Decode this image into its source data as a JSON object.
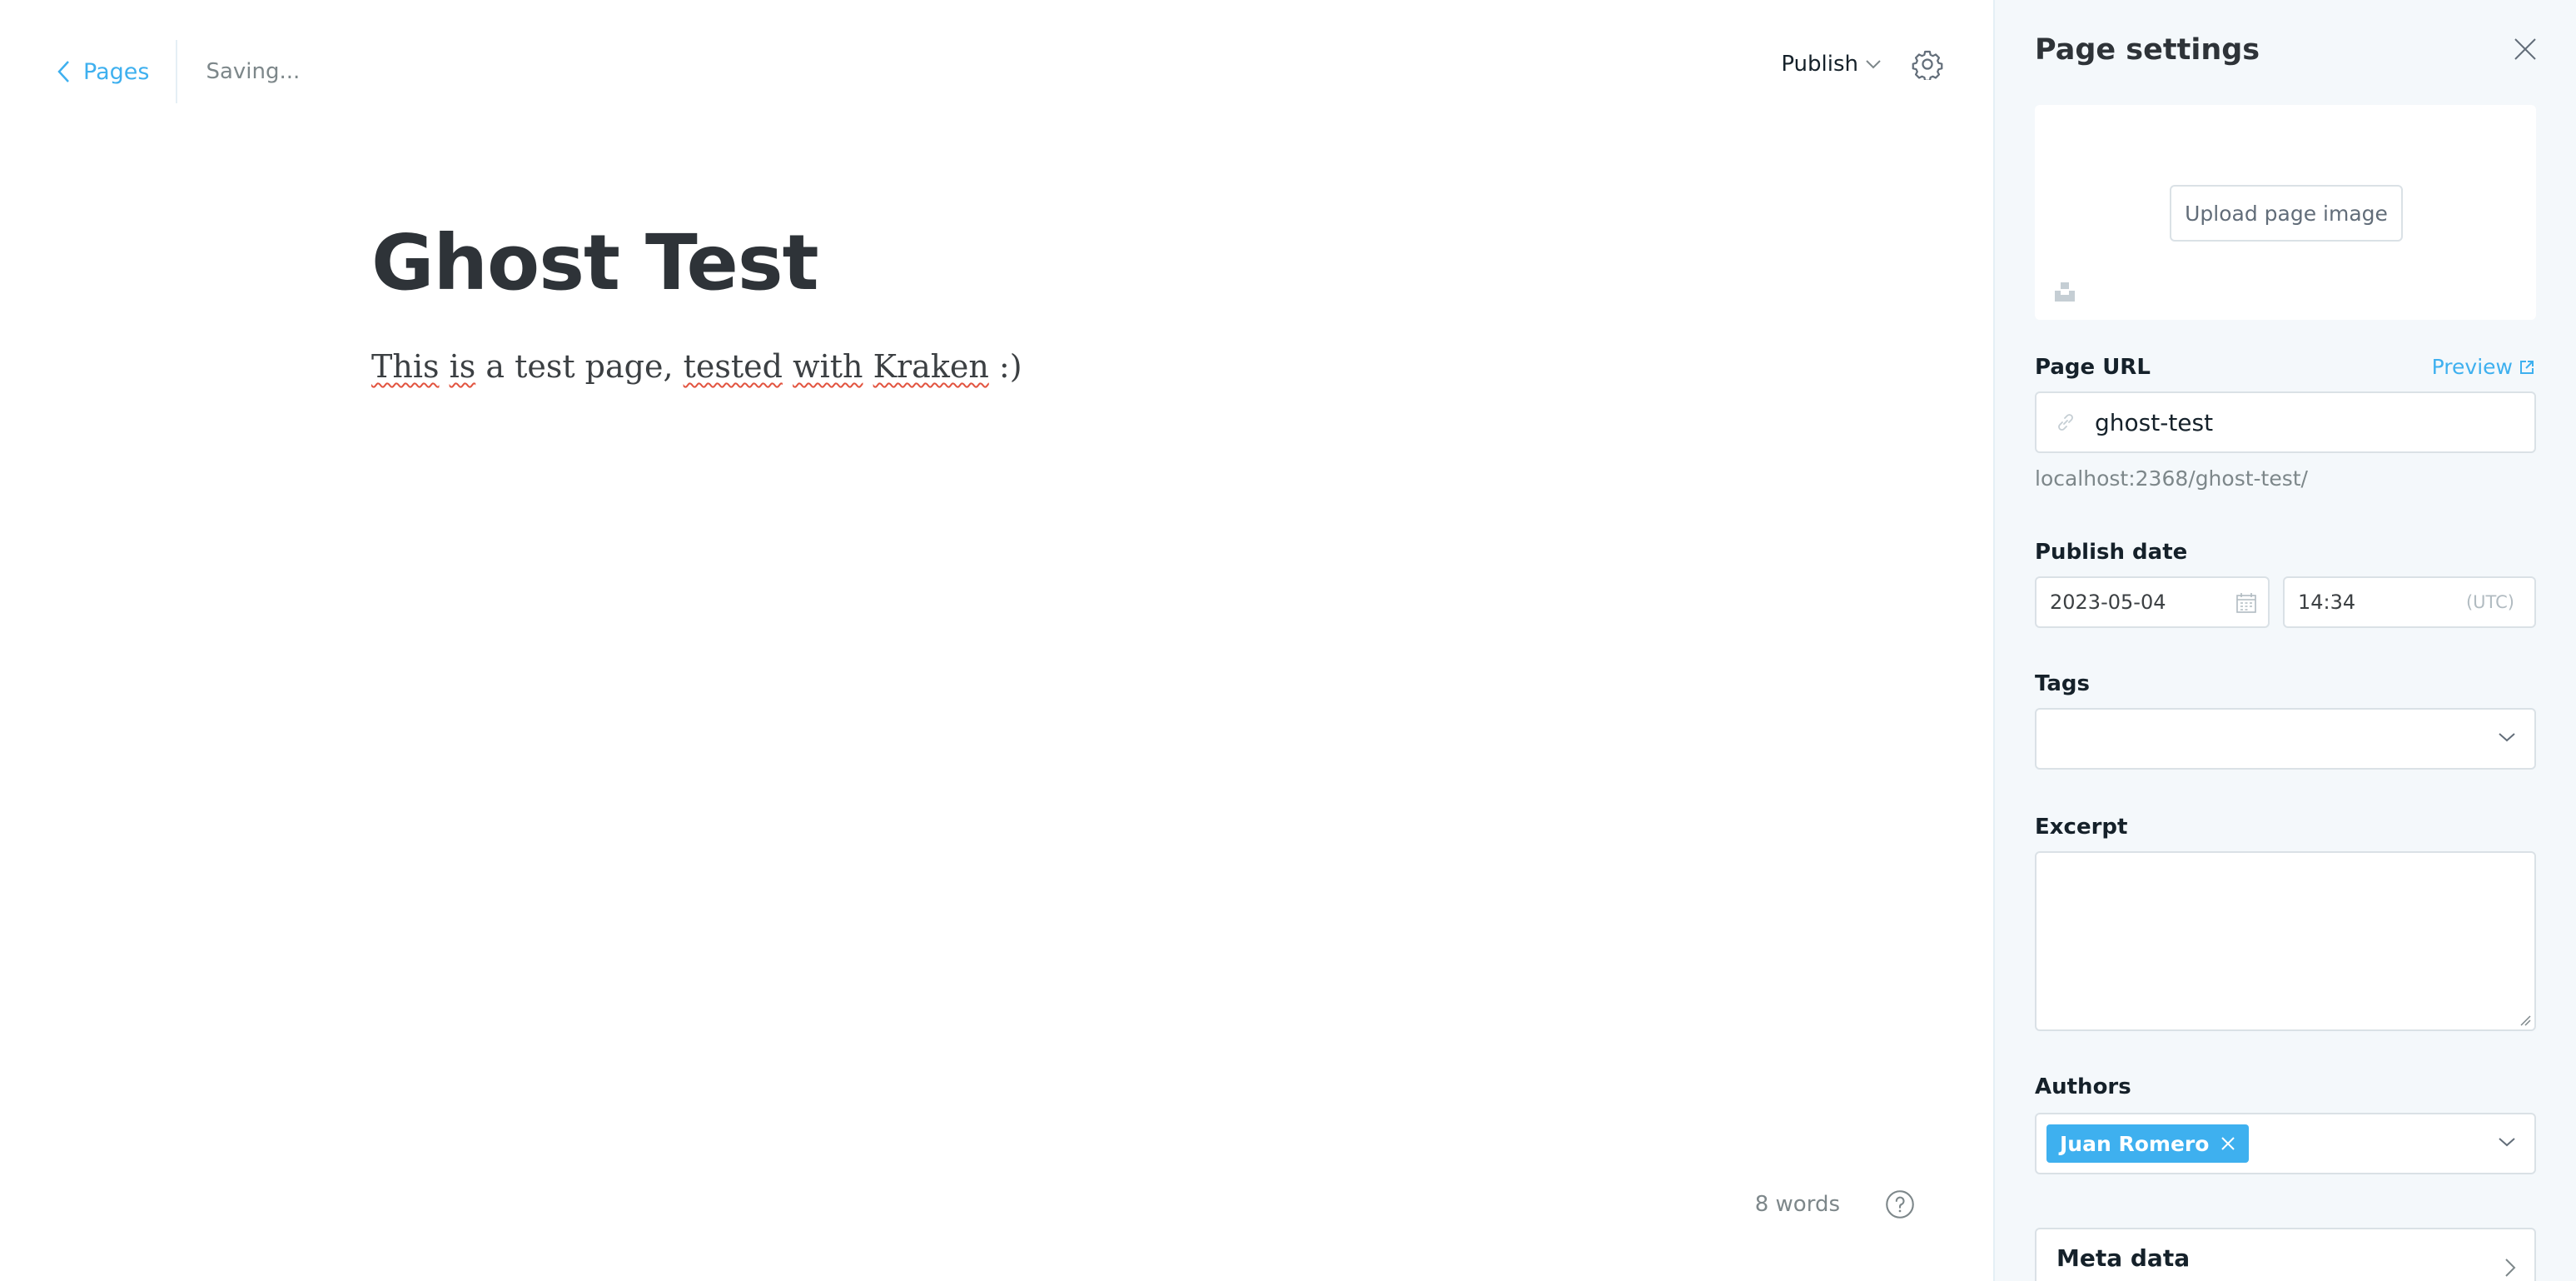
{
  "editor": {
    "back_label": "Pages",
    "status": "Saving...",
    "publish_label": "Publish",
    "title": "Ghost Test",
    "body": {
      "parts": [
        "This",
        "is",
        "a test page,",
        "tested",
        "with",
        "Kraken",
        ":)"
      ]
    },
    "word_count": "8 words"
  },
  "panel": {
    "header": "Page settings",
    "upload_label": "Upload page image",
    "page_url_label": "Page URL",
    "preview_label": "Preview",
    "slug": "ghost-test",
    "url_hint": "localhost:2368/ghost-test/",
    "publish_date_label": "Publish date",
    "date": "2023-05-04",
    "time": "14:34",
    "timezone": "(UTC)",
    "tags_label": "Tags",
    "excerpt_label": "Excerpt",
    "authors_label": "Authors",
    "author": "Juan Romero",
    "meta_label": "Meta data"
  },
  "colors": {
    "accent": "#3eb0ef",
    "panel_bg": "#f4f8fb",
    "text_dark": "#15212a",
    "muted": "#7d878a"
  },
  "icons": [
    "chevron-left-icon",
    "chevron-down-icon",
    "gear-icon",
    "help-icon",
    "close-icon",
    "unsplash-icon",
    "link-icon",
    "external-link-icon",
    "calendar-icon",
    "remove-icon",
    "chevron-right-icon"
  ]
}
